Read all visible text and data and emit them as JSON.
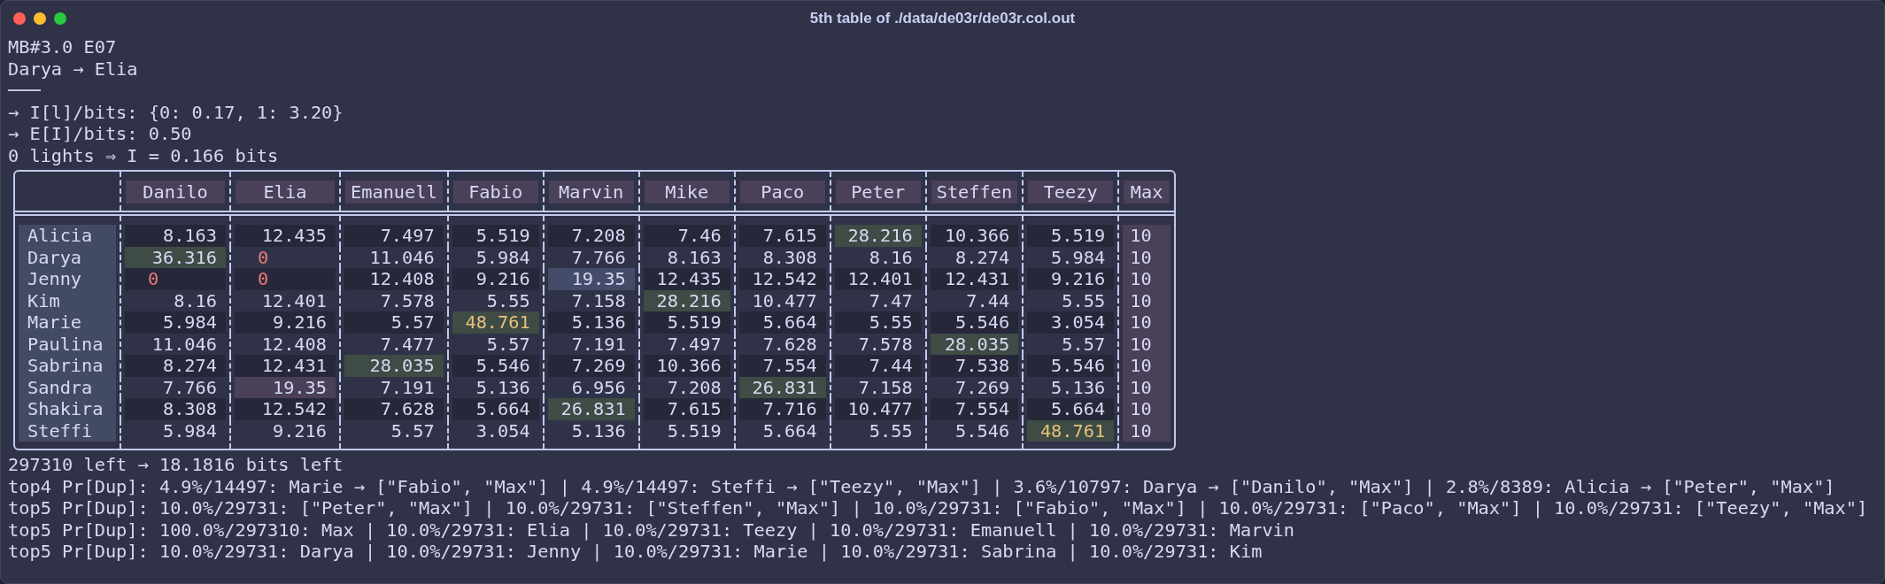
{
  "window": {
    "title": "5th table of ./data/de03r/de03r.col.out"
  },
  "header_lines": [
    "MB#3.0 E07",
    "Darya → Elia",
    "───",
    "→ I[l]/bits: {0: 0.17, 1: 3.20}",
    "→ E[I]/bits: 0.50",
    "0 lights ⇒ I = 0.166 bits"
  ],
  "table": {
    "columns": [
      {
        "label": "Danilo",
        "kind": "person"
      },
      {
        "label": "Elia",
        "kind": "person"
      },
      {
        "label": "Emanuell",
        "kind": "person"
      },
      {
        "label": "Fabio",
        "kind": "person"
      },
      {
        "label": "Marvin",
        "kind": "person"
      },
      {
        "label": "Mike",
        "kind": "person"
      },
      {
        "label": "Paco",
        "kind": "person"
      },
      {
        "label": "Peter",
        "kind": "person"
      },
      {
        "label": "Steffen",
        "kind": "person"
      },
      {
        "label": "Teezy",
        "kind": "person"
      },
      {
        "label": "Max",
        "kind": "total"
      }
    ],
    "rows": [
      {
        "name": "Alicia",
        "cells": [
          {
            "text": "8.163",
            "kind": "plain"
          },
          {
            "text": "12.435",
            "kind": "plain"
          },
          {
            "text": "7.497",
            "kind": "plain"
          },
          {
            "text": "5.519",
            "kind": "plain"
          },
          {
            "text": "7.208",
            "kind": "plain"
          },
          {
            "text": "7.46",
            "kind": "plain"
          },
          {
            "text": "7.615",
            "kind": "plain"
          },
          {
            "text": "28.216",
            "kind": "green"
          },
          {
            "text": "10.366",
            "kind": "plain"
          },
          {
            "text": "5.519",
            "kind": "plain"
          },
          {
            "text": "10",
            "kind": "plain"
          }
        ]
      },
      {
        "name": "Darya",
        "cells": [
          {
            "text": "36.316",
            "kind": "green"
          },
          {
            "text": "0",
            "kind": "zero"
          },
          {
            "text": "11.046",
            "kind": "plain"
          },
          {
            "text": "5.984",
            "kind": "plain"
          },
          {
            "text": "7.766",
            "kind": "plain"
          },
          {
            "text": "8.163",
            "kind": "plain"
          },
          {
            "text": "8.308",
            "kind": "plain"
          },
          {
            "text": "8.16",
            "kind": "plain"
          },
          {
            "text": "8.274",
            "kind": "plain"
          },
          {
            "text": "5.984",
            "kind": "plain"
          },
          {
            "text": "10",
            "kind": "plain"
          }
        ]
      },
      {
        "name": "Jenny",
        "cells": [
          {
            "text": "0",
            "kind": "zero"
          },
          {
            "text": "0",
            "kind": "zero"
          },
          {
            "text": "12.408",
            "kind": "plain"
          },
          {
            "text": "9.216",
            "kind": "plain"
          },
          {
            "text": "19.35",
            "kind": "slate"
          },
          {
            "text": "12.435",
            "kind": "plain"
          },
          {
            "text": "12.542",
            "kind": "plain"
          },
          {
            "text": "12.401",
            "kind": "plain"
          },
          {
            "text": "12.431",
            "kind": "plain"
          },
          {
            "text": "9.216",
            "kind": "plain"
          },
          {
            "text": "10",
            "kind": "plain"
          }
        ]
      },
      {
        "name": "Kim",
        "cells": [
          {
            "text": "8.16",
            "kind": "plain"
          },
          {
            "text": "12.401",
            "kind": "plain"
          },
          {
            "text": "7.578",
            "kind": "plain"
          },
          {
            "text": "5.55",
            "kind": "plain"
          },
          {
            "text": "7.158",
            "kind": "plain"
          },
          {
            "text": "28.216",
            "kind": "green"
          },
          {
            "text": "10.477",
            "kind": "plain"
          },
          {
            "text": "7.47",
            "kind": "plain"
          },
          {
            "text": "7.44",
            "kind": "plain"
          },
          {
            "text": "5.55",
            "kind": "plain"
          },
          {
            "text": "10",
            "kind": "plain"
          }
        ]
      },
      {
        "name": "Marie",
        "cells": [
          {
            "text": "5.984",
            "kind": "plain"
          },
          {
            "text": "9.216",
            "kind": "plain"
          },
          {
            "text": "5.57",
            "kind": "plain"
          },
          {
            "text": "48.761",
            "kind": "gold"
          },
          {
            "text": "5.136",
            "kind": "plain"
          },
          {
            "text": "5.519",
            "kind": "plain"
          },
          {
            "text": "5.664",
            "kind": "plain"
          },
          {
            "text": "5.55",
            "kind": "plain"
          },
          {
            "text": "5.546",
            "kind": "plain"
          },
          {
            "text": "3.054",
            "kind": "plain"
          },
          {
            "text": "10",
            "kind": "plain"
          }
        ]
      },
      {
        "name": "Paulina",
        "cells": [
          {
            "text": "11.046",
            "kind": "plain"
          },
          {
            "text": "12.408",
            "kind": "plain"
          },
          {
            "text": "7.477",
            "kind": "plain"
          },
          {
            "text": "5.57",
            "kind": "plain"
          },
          {
            "text": "7.191",
            "kind": "plain"
          },
          {
            "text": "7.497",
            "kind": "plain"
          },
          {
            "text": "7.628",
            "kind": "plain"
          },
          {
            "text": "7.578",
            "kind": "plain"
          },
          {
            "text": "28.035",
            "kind": "green"
          },
          {
            "text": "5.57",
            "kind": "plain"
          },
          {
            "text": "10",
            "kind": "plain"
          }
        ]
      },
      {
        "name": "Sabrina",
        "cells": [
          {
            "text": "8.274",
            "kind": "plain"
          },
          {
            "text": "12.431",
            "kind": "plain"
          },
          {
            "text": "28.035",
            "kind": "green"
          },
          {
            "text": "5.546",
            "kind": "plain"
          },
          {
            "text": "7.269",
            "kind": "plain"
          },
          {
            "text": "10.366",
            "kind": "plain"
          },
          {
            "text": "7.554",
            "kind": "plain"
          },
          {
            "text": "7.44",
            "kind": "plain"
          },
          {
            "text": "7.538",
            "kind": "plain"
          },
          {
            "text": "5.546",
            "kind": "plain"
          },
          {
            "text": "10",
            "kind": "plain"
          }
        ]
      },
      {
        "name": "Sandra",
        "cells": [
          {
            "text": "7.766",
            "kind": "plain"
          },
          {
            "text": "19.35",
            "kind": "rose"
          },
          {
            "text": "7.191",
            "kind": "plain"
          },
          {
            "text": "5.136",
            "kind": "plain"
          },
          {
            "text": "6.956",
            "kind": "plain"
          },
          {
            "text": "7.208",
            "kind": "plain"
          },
          {
            "text": "26.831",
            "kind": "green"
          },
          {
            "text": "7.158",
            "kind": "plain"
          },
          {
            "text": "7.269",
            "kind": "plain"
          },
          {
            "text": "5.136",
            "kind": "plain"
          },
          {
            "text": "10",
            "kind": "plain"
          }
        ]
      },
      {
        "name": "Shakira",
        "cells": [
          {
            "text": "8.308",
            "kind": "plain"
          },
          {
            "text": "12.542",
            "kind": "plain"
          },
          {
            "text": "7.628",
            "kind": "plain"
          },
          {
            "text": "5.664",
            "kind": "plain"
          },
          {
            "text": "26.831",
            "kind": "green"
          },
          {
            "text": "7.615",
            "kind": "plain"
          },
          {
            "text": "7.716",
            "kind": "plain"
          },
          {
            "text": "10.477",
            "kind": "plain"
          },
          {
            "text": "7.554",
            "kind": "plain"
          },
          {
            "text": "5.664",
            "kind": "plain"
          },
          {
            "text": "10",
            "kind": "plain"
          }
        ]
      },
      {
        "name": "Steffi",
        "cells": [
          {
            "text": "5.984",
            "kind": "plain"
          },
          {
            "text": "9.216",
            "kind": "plain"
          },
          {
            "text": "5.57",
            "kind": "plain"
          },
          {
            "text": "3.054",
            "kind": "plain"
          },
          {
            "text": "5.136",
            "kind": "plain"
          },
          {
            "text": "5.519",
            "kind": "plain"
          },
          {
            "text": "5.664",
            "kind": "plain"
          },
          {
            "text": "5.55",
            "kind": "plain"
          },
          {
            "text": "5.546",
            "kind": "plain"
          },
          {
            "text": "48.761",
            "kind": "gold"
          },
          {
            "text": "10",
            "kind": "plain"
          }
        ]
      }
    ]
  },
  "footer_lines": [
    "297310 left → 18.1816 bits left",
    "top4 Pr[Dup]: 4.9%/14497: Marie → [\"Fabio\", \"Max\"] | 4.9%/14497: Steffi → [\"Teezy\", \"Max\"] | 3.6%/10797: Darya → [\"Danilo\", \"Max\"] | 2.8%/8389: Alicia → [\"Peter\", \"Max\"]",
    "top5 Pr[Dup]: 10.0%/29731: [\"Peter\", \"Max\"] | 10.0%/29731: [\"Steffen\", \"Max\"] | 10.0%/29731: [\"Fabio\", \"Max\"] | 10.0%/29731: [\"Paco\", \"Max\"] | 10.0%/29731: [\"Teezy\", \"Max\"]",
    "top5 Pr[Dup]: 100.0%/297310: Max | 10.0%/29731: Elia | 10.0%/29731: Teezy | 10.0%/29731: Emanuell | 10.0%/29731: Marvin",
    "top5 Pr[Dup]: 10.0%/29731: Darya | 10.0%/29731: Jenny | 10.0%/29731: Marie | 10.0%/29731: Sabrina | 10.0%/29731: Kim"
  ]
}
